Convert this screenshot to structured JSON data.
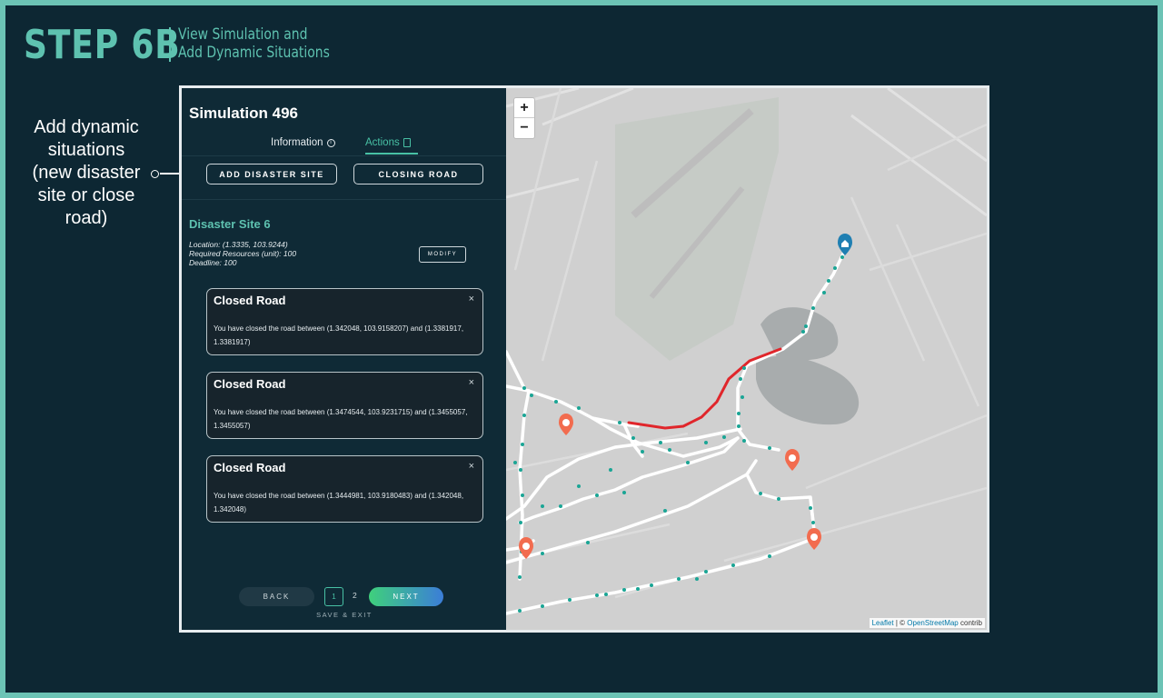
{
  "header": {
    "step": "STEP 6B",
    "subtitle_line1": "View Simulation and",
    "subtitle_line2": "Add Dynamic Situations"
  },
  "annotation": {
    "line1": "Add dynamic",
    "line2": "situations",
    "line3": "(new disaster",
    "line4": "site or close",
    "line5": "road)"
  },
  "panel": {
    "title": "Simulation 496",
    "tabs": [
      {
        "label": "Information",
        "active": false,
        "icon": "info-icon"
      },
      {
        "label": "Actions",
        "active": true,
        "icon": "document-icon"
      }
    ],
    "actions": {
      "add_site": "ADD DISASTER SITE",
      "closing_road": "CLOSING ROAD"
    },
    "site": {
      "title": "Disaster Site 6",
      "location": "Location: (1.3335, 103.9244)",
      "resources": "Required Resources (unit): 100",
      "deadline": "Deadline: 100",
      "modify": "MODIFY"
    },
    "cards": [
      {
        "title": "Closed Road",
        "close": "×",
        "text": "You have closed the road between (1.342048, 103.9158207) and (1.3381917, 1.3381917)"
      },
      {
        "title": "Closed Road",
        "close": "×",
        "text": "You have closed the road between (1.3474544, 103.9231715) and (1.3455057, 1.3455057)"
      },
      {
        "title": "Closed Road",
        "close": "×",
        "text": "You have closed the road between (1.3444981, 103.9180483) and (1.342048, 1.342048)"
      }
    ],
    "pagination": {
      "back": "BACK",
      "page1": "1",
      "page2": "2",
      "next": "NEXT",
      "current_page": 1,
      "save_exit": "SAVE & EXIT"
    }
  },
  "map": {
    "zoom_in": "+",
    "zoom_out": "−",
    "attribution_leaflet": "Leaflet",
    "attribution_sep": " | © ",
    "attribution_osm": "OpenStreetMap",
    "attribution_tail": " contrib",
    "colors": {
      "route": "#ffffff",
      "closed_road": "#e0262b",
      "node": "#1aa595",
      "marker_site": "#f26c4f",
      "marker_depot": "#1f7fb2"
    }
  }
}
